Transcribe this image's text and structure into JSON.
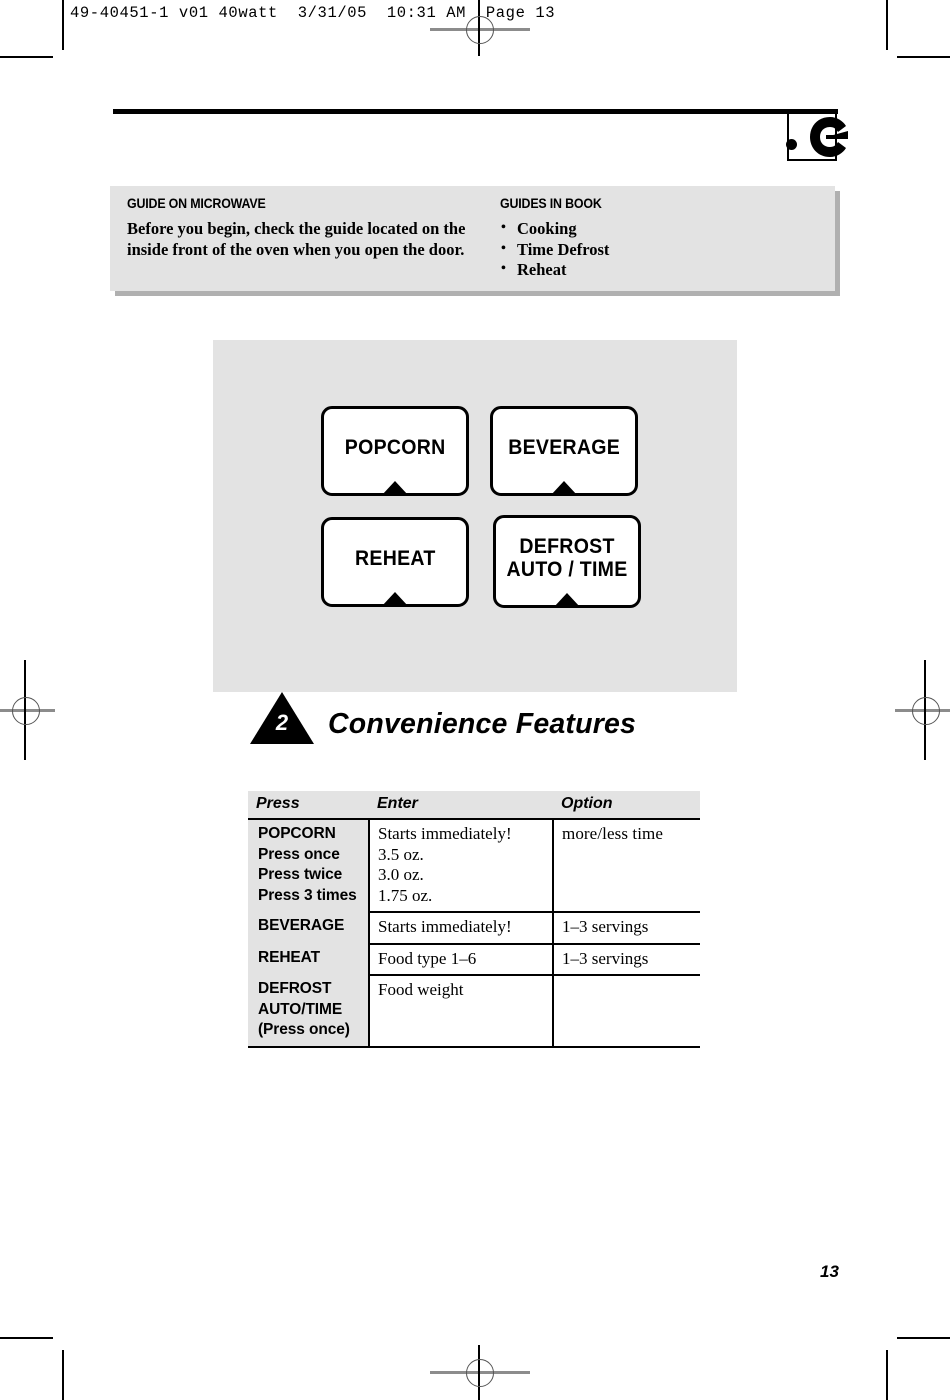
{
  "slug": {
    "text": "49-40451-1 v01 40watt  3/31/05  10:31 AM  Page 13"
  },
  "guide_box": {
    "left": {
      "title": "GUIDE ON MICROWAVE",
      "body": "Before you begin, check the guide located on the inside front of the oven when you open the door."
    },
    "right": {
      "title": "GUIDES IN BOOK",
      "items": [
        "Cooking",
        "Time Defrost",
        "Reheat"
      ]
    }
  },
  "panel": {
    "buttons": [
      {
        "label": "POPCORN"
      },
      {
        "label": "BEVERAGE"
      },
      {
        "label": "REHEAT"
      },
      {
        "label": "DEFROST\nAUTO / TIME"
      }
    ]
  },
  "section": {
    "number": "2",
    "title": "Convenience Features"
  },
  "table": {
    "headers": [
      "Press",
      "Enter",
      "Option"
    ],
    "rows": [
      {
        "press": "POPCORN\nPress once\nPress twice\nPress 3 times",
        "enter": "Starts immediately!\n3.5 oz.\n3.0 oz.\n1.75 oz.",
        "option": "more/less  time"
      },
      {
        "press": "BEVERAGE",
        "enter": "Starts immediately!",
        "option": "1–3 servings"
      },
      {
        "press": "REHEAT",
        "enter": "Food type 1–6",
        "option": "1–3 servings"
      },
      {
        "press": "DEFROST\nAUTO/TIME\n(Press once)",
        "enter": "Food weight",
        "option": ""
      }
    ]
  },
  "footer": {
    "page_number": "13"
  },
  "colors": {
    "panel_gray": "#e3e3e3",
    "shadow_gray": "#b0b0b0",
    "ink": "#000000",
    "reg_mark_gray": "#8c8c8c"
  }
}
